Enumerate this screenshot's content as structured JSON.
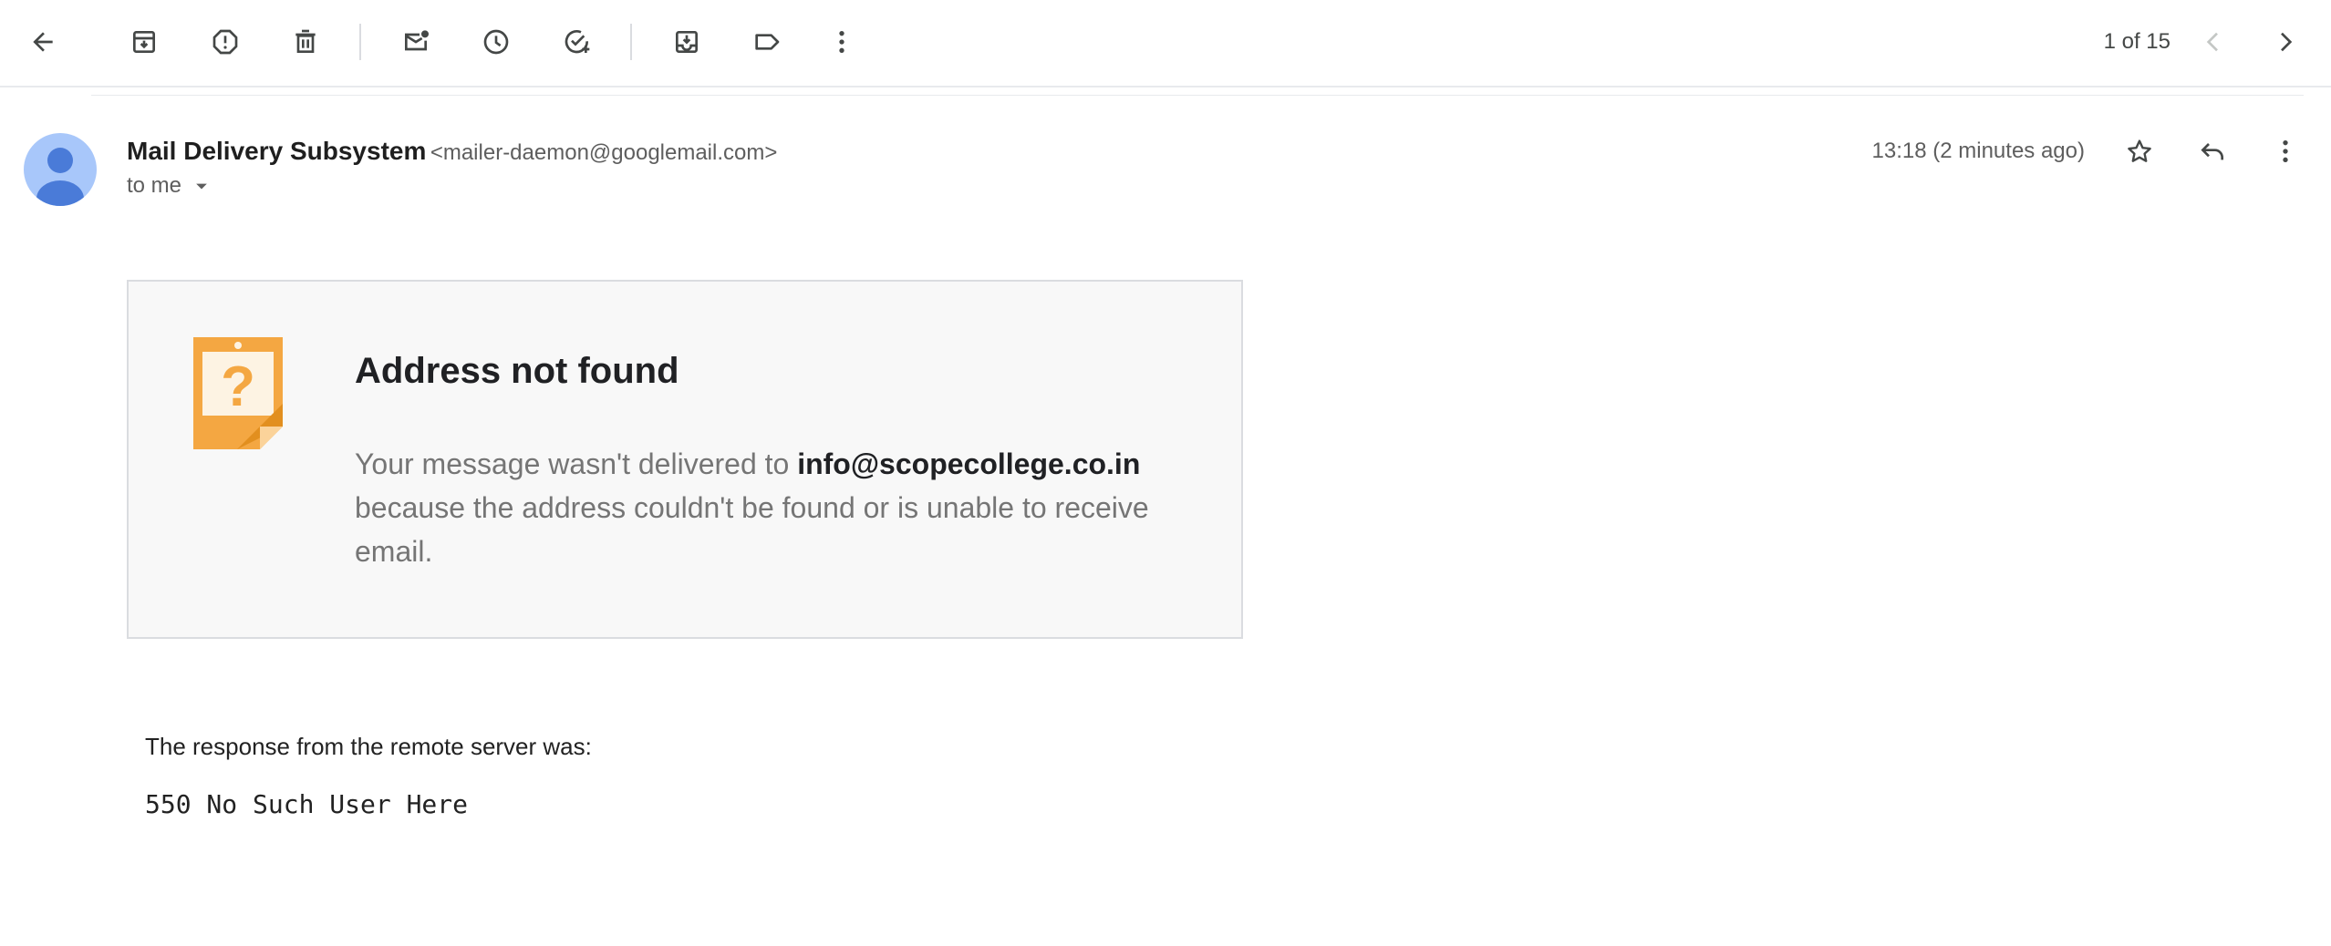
{
  "toolbar": {
    "actions": [
      {
        "icon": "back-arrow-icon"
      },
      {
        "icon": "archive-icon"
      },
      {
        "icon": "report-spam-icon"
      },
      {
        "icon": "delete-icon"
      },
      {
        "icon": "mark-unread-icon"
      },
      {
        "icon": "snooze-icon"
      },
      {
        "icon": "add-to-tasks-icon"
      },
      {
        "icon": "move-to-icon"
      },
      {
        "icon": "label-icon"
      },
      {
        "icon": "more-vert-icon"
      }
    ],
    "counter": "1 of 15"
  },
  "message": {
    "sender_name": "Mail Delivery Subsystem",
    "sender_email": "<mailer-daemon@googlemail.com>",
    "recipient": "to me",
    "timestamp": "13:18 (2 minutes ago)"
  },
  "bounce": {
    "title": "Address not found",
    "body_prefix": "Your message wasn't delivered to ",
    "address": "info@scopecollege.co.in",
    "body_suffix": " because the address couldn't be found or is unable to receive email."
  },
  "response": {
    "label": "The response from the remote server was:",
    "code": "550 No Such User Here"
  },
  "colors": {
    "icon": "#444746",
    "avatar_bg": "#a8c7fa",
    "avatar_fg": "#4a7bd8",
    "warning": "#f4a742"
  }
}
